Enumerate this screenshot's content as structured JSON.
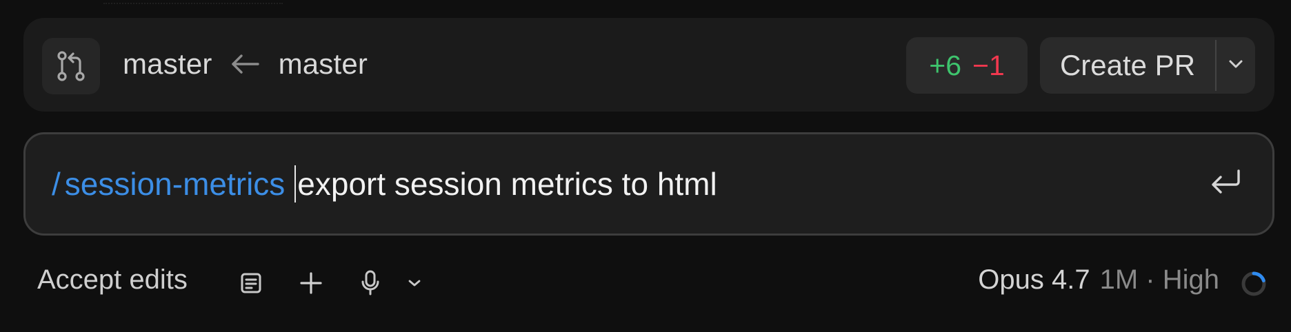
{
  "branch_bar": {
    "icon": "git-pull-request-icon",
    "target_branch": "master",
    "arrow_icon": "arrow-left-icon",
    "source_branch": "master",
    "diff": {
      "added": "+6",
      "removed": "−1"
    },
    "create_pr_label": "Create PR",
    "dropdown_icon": "chevron-down-icon"
  },
  "prompt": {
    "slash": "/",
    "command": "session-metrics",
    "text": "export session metrics to html",
    "submit_icon": "enter-return-icon"
  },
  "toolbar": {
    "mode_label": "Accept edits",
    "icons": [
      "document-icon",
      "plus-icon",
      "microphone-icon",
      "chevron-down-icon"
    ],
    "model_name": "Opus 4.7",
    "model_meta": "1M · High",
    "status_icon": "progress-ring-icon"
  },
  "colors": {
    "accent_blue": "#3c8ee6",
    "diff_add": "#3ec46d",
    "diff_remove": "#f1384f",
    "background": "#0f0f0f",
    "panel": "#1b1b1b"
  }
}
